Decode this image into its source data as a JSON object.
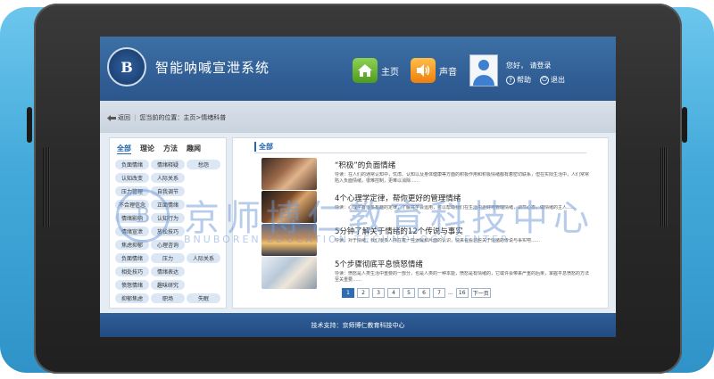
{
  "app": {
    "title": "智能呐喊宣泄系统",
    "logo_text": "B"
  },
  "nav": {
    "home_label": "主页",
    "sound_label": "声音"
  },
  "user": {
    "greeting": "您好，  请登录",
    "help_label": "帮助",
    "logout_label": "退出"
  },
  "breadcrumb": {
    "back_label": "返回",
    "text": "您当前的位置：主页>情绪科普"
  },
  "categories": {
    "tabs": [
      "全部",
      "理论",
      "方法",
      "趣闻"
    ],
    "tags": [
      "负面情绪",
      "情绪释疑",
      "愁怨",
      "认知改变",
      "人际关系",
      "",
      "压力管理",
      "自我调节",
      "",
      "不合理信念",
      "正面情绪",
      "",
      "情绪影响",
      "认知行为",
      "",
      "情绪宣泄",
      "放松技巧",
      "",
      "焦虑抑郁",
      "心理咨询",
      "",
      "负面情绪",
      "压力",
      "人际关系",
      "相处技巧",
      "情绪表达",
      "",
      "愤怒情绪",
      "趣味研究",
      "",
      "抑郁焦虑",
      "职场",
      "失眠"
    ]
  },
  "articles_header": "全部",
  "articles": [
    {
      "title": "“积极”的负面情绪",
      "body": "导读：在人们的通常认知中，忧虑、认知以及身体健康等方面的积极作用和积极情绪都有着密切联系，但在实际生活中，人们常常陷入负面情绪，很难控制，更难以消除……"
    },
    {
      "title": "4个心理学定律，帮你更好的管理情绪",
      "body": "导读：心理学有很多有趣的定律，了解并学会运用，可以帮助我们在生活中更好地管理情绪，调节心态，做情绪的主人……"
    },
    {
      "title": "5分钟了解关于情绪的12个传说与事实",
      "body": "导读：对于情绪，我们很多人存在着一些误解和片面的认识，快来看看这些关于情绪的传说与事实吧……"
    },
    {
      "title": "5个步骤彻底平息愤怒情绪",
      "body": "导读：愤怒是人类生活中重要的一部分，也是人类的一种本能，愤怒是有情绪的，它或许会带来严重的后果，掌握平息愤怒的方法至关重要……"
    }
  ],
  "pager": {
    "pages": [
      "1",
      "2",
      "3",
      "4",
      "5",
      "6",
      "7"
    ],
    "ellipsis": "...",
    "last_page": "16",
    "next_label": "下一页",
    "current": "1"
  },
  "footer": {
    "text": "技术支持：京师博仁教育科技中心"
  },
  "watermark": {
    "seal": "B",
    "cn": "京师博仁教育科技中心",
    "en": "BNUBOREN EDUCATION TECHNOLOGY CENTER"
  },
  "colors": {
    "header": "#2a568c",
    "frame": "#43a9da",
    "accent": "#2566b0"
  }
}
